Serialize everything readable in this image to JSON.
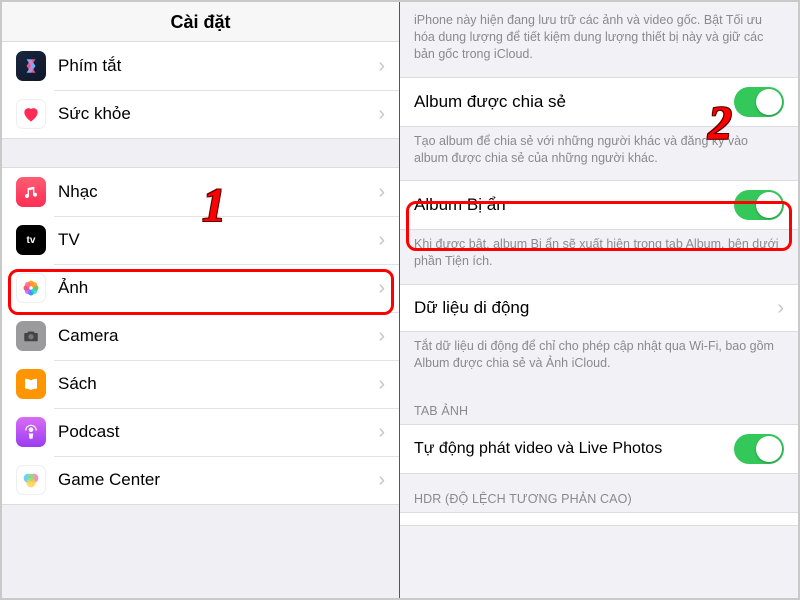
{
  "left": {
    "title": "Cài đặt",
    "group1": [
      {
        "label": "Phím tắt"
      },
      {
        "label": "Sức khỏe"
      }
    ],
    "group2": [
      {
        "label": "Nhạc"
      },
      {
        "label": "TV"
      },
      {
        "label": "Ảnh"
      },
      {
        "label": "Camera"
      },
      {
        "label": "Sách"
      },
      {
        "label": "Podcast"
      },
      {
        "label": "Game Center"
      }
    ]
  },
  "right": {
    "top_note": "iPhone này hiện đang lưu trữ các ảnh và video gốc. Bật Tối ưu hóa dung lượng để tiết kiệm dung lượng thiết bị này và giữ các bản gốc trong iCloud.",
    "shared_album": "Album được chia sẻ",
    "shared_note": "Tạo album để chia sẻ với những người khác và đăng ký vào album được chia sẻ của những người khác.",
    "hidden_album": "Album Bị ẩn",
    "hidden_note": "Khi được bật, album Bị ẩn sẽ xuất hiện trong tab Album, bên dưới phần Tiện ích.",
    "cellular": "Dữ liệu di động",
    "cellular_note": "Tắt dữ liệu di động để chỉ cho phép cập nhật qua Wi-Fi, bao gồm Album được chia sẻ và Ảnh iCloud.",
    "tab_photos_header": "TAB ẢNH",
    "autoplay": "Tự động phát video và Live Photos",
    "hdr_header": "HDR (ĐỘ LỆCH TƯƠNG PHẢN CAO)"
  },
  "annotations": {
    "step1": "1",
    "step2": "2"
  }
}
